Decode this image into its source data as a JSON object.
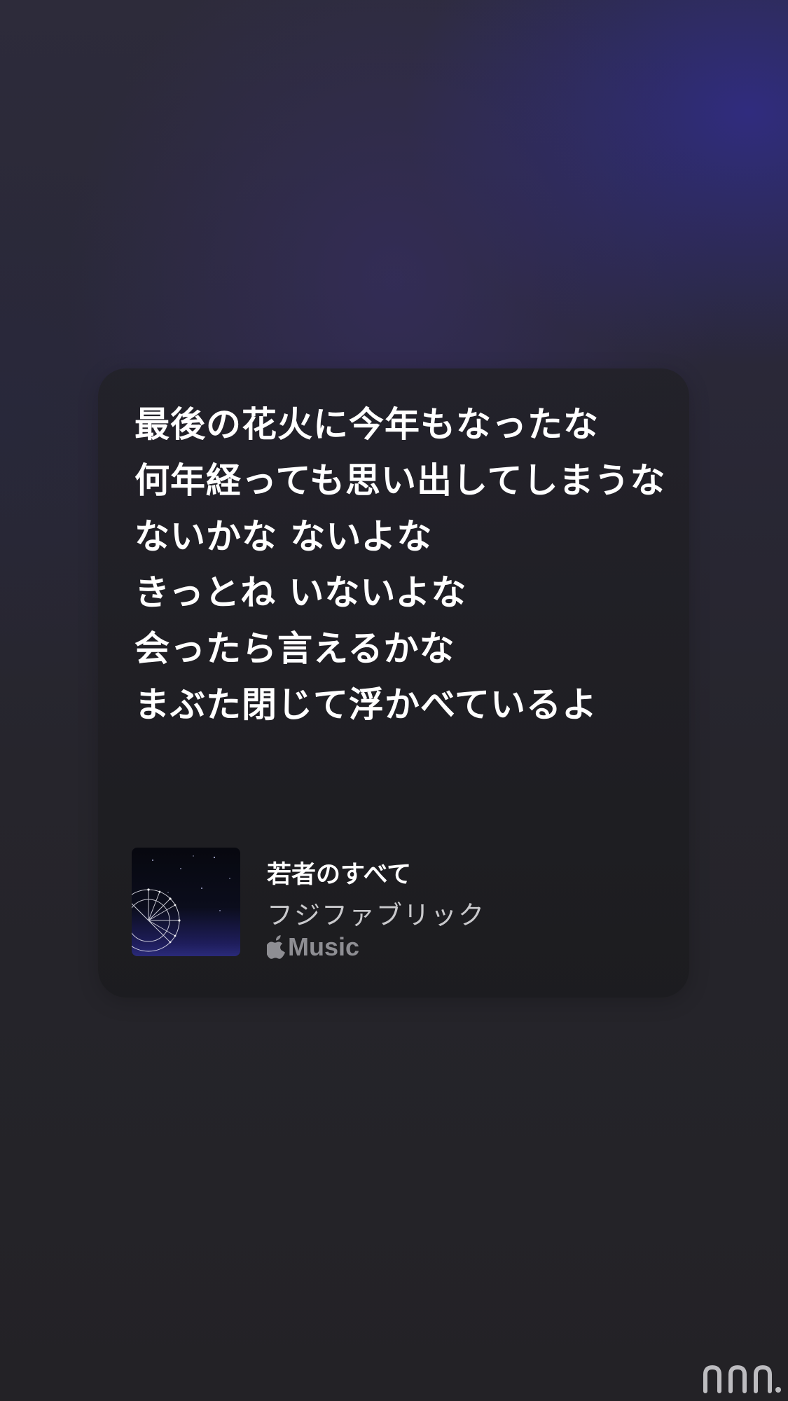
{
  "lyrics_card": {
    "lines": [
      "最後の花火に今年もなったな",
      "何年経っても思い出してしまうな",
      "ないかな ないよな",
      "きっとね いないよな",
      "会ったら言えるかな",
      "まぶた閉じて浮かべているよ"
    ],
    "track": {
      "title": "若者のすべて",
      "artist": "フジファブリック",
      "artwork_icon": "ferris-wheel-night-artwork",
      "service": {
        "icon": "apple-logo-icon",
        "label": "Music"
      }
    }
  },
  "watermark": {
    "icon": "watermark-logo-icon"
  },
  "colors": {
    "lyric_text": "#ffffff",
    "artist_text": "#c9c9cc",
    "service_text": "#8e8e93",
    "card_bg": "#1f1e24",
    "accent_purple": "#302c82"
  }
}
